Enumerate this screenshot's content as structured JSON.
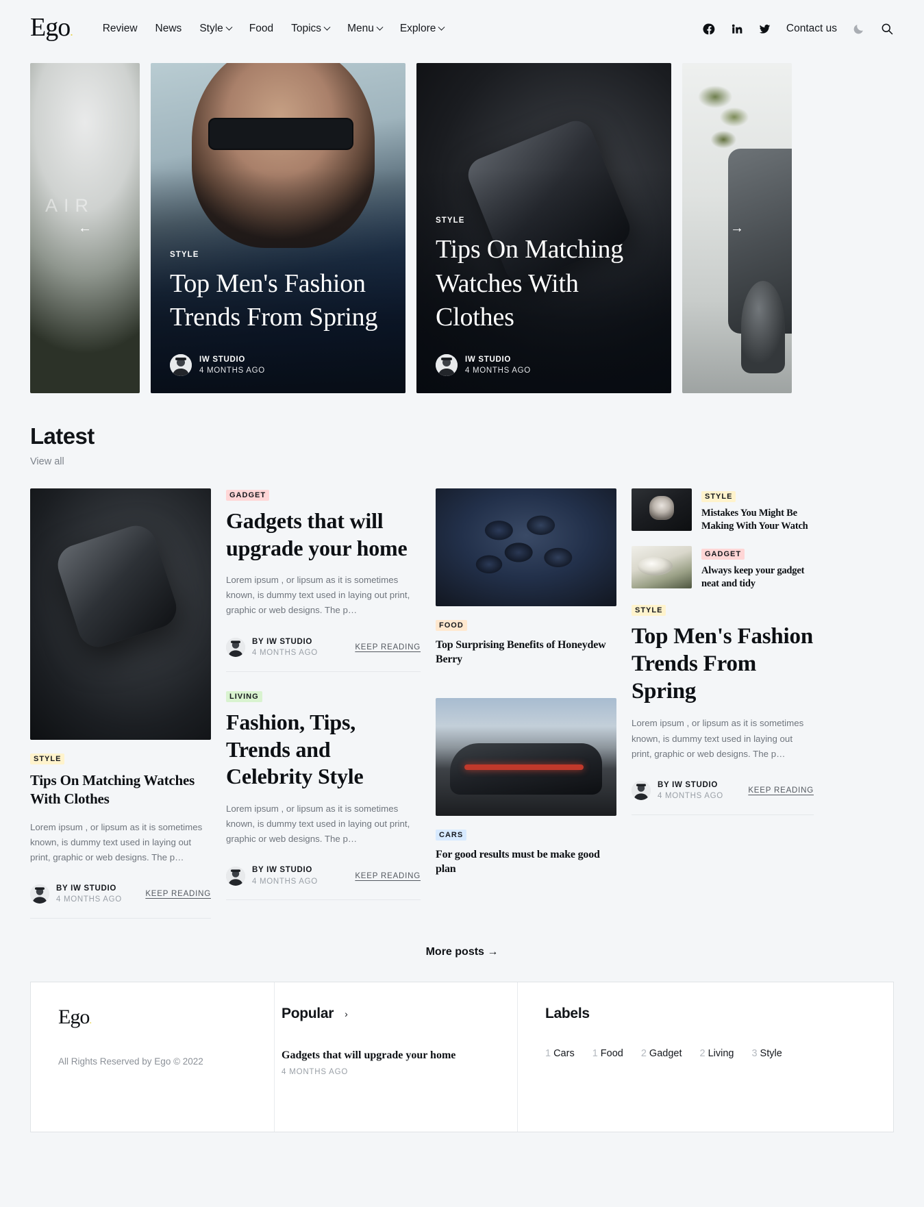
{
  "header": {
    "brand": "Ego",
    "brand_dot": ".",
    "nav": [
      {
        "label": "Review",
        "has_caret": false
      },
      {
        "label": "News",
        "has_caret": false
      },
      {
        "label": "Style",
        "has_caret": true
      },
      {
        "label": "Food",
        "has_caret": false
      },
      {
        "label": "Topics",
        "has_caret": true
      },
      {
        "label": "Menu",
        "has_caret": true
      },
      {
        "label": "Explore",
        "has_caret": true
      }
    ],
    "social": [
      "facebook-icon",
      "linkedin-icon",
      "twitter-icon"
    ],
    "contact_label": "Contact us",
    "dark_mode_icon": "moon-icon",
    "search_icon": "search-icon"
  },
  "hero": {
    "prev_arrow": "←",
    "next_arrow": "→",
    "slides": [
      {
        "kicker": "STYLE",
        "title": "Top Men's Fashion Trends From Spring",
        "author": "IW STUDIO",
        "date": "4 MONTHS AGO"
      },
      {
        "kicker": "STYLE",
        "title": "Tips On Matching Watches With Clothes",
        "author": "IW STUDIO",
        "date": "4 MONTHS AGO"
      }
    ]
  },
  "latest": {
    "heading": "Latest",
    "view_all": "View all",
    "keep_reading": "KEEP READING",
    "by_prefix": "BY",
    "excerpt": "Lorem ipsum , or lipsum as it is sometimes known, is dummy text used in laying out print, graphic or web designs. The p…",
    "col1": {
      "tag": "STYLE",
      "title": "Tips On Matching Watches With Clothes",
      "author": "IW STUDIO",
      "date": "4 MONTHS AGO"
    },
    "col2": {
      "top": {
        "tag": "GADGET",
        "title": "Gadgets that will upgrade your home",
        "author": "IW STUDIO",
        "date": "4 MONTHS AGO"
      },
      "bottom": {
        "tag": "LIVING",
        "title": "Fashion, Tips, Trends and Celebrity Style",
        "author": "IW STUDIO",
        "date": "4 MONTHS AGO"
      }
    },
    "col3": {
      "top": {
        "tag": "FOOD",
        "title": "Top Surprising Benefits of Honeydew Berry"
      },
      "bottom": {
        "tag": "CARS",
        "title": "For good results must be make good plan"
      }
    },
    "col4": {
      "mini": [
        {
          "tag": "STYLE",
          "title": "Mistakes You Might Be Making With Your Watch"
        },
        {
          "tag": "GADGET",
          "title": "Always keep your gadget neat and tidy"
        }
      ],
      "feature": {
        "tag": "STYLE",
        "title": "Top Men's Fashion Trends From Spring",
        "author": "IW STUDIO",
        "date": "4 MONTHS AGO"
      }
    },
    "more_posts": "More posts",
    "more_posts_arrow": "→"
  },
  "footer": {
    "brand": "Ego",
    "brand_dot": ".",
    "rights": "All Rights Reserved by Ego © 2022",
    "popular_heading": "Popular",
    "popular_chevron": "›",
    "popular_post_title": "Gadgets that will upgrade your home",
    "popular_post_date": "4 MONTHS AGO",
    "labels_heading": "Labels",
    "labels": [
      {
        "count": "1",
        "name": "Cars"
      },
      {
        "count": "1",
        "name": "Food"
      },
      {
        "count": "2",
        "name": "Gadget"
      },
      {
        "count": "2",
        "name": "Living"
      },
      {
        "count": "3",
        "name": "Style"
      }
    ]
  }
}
